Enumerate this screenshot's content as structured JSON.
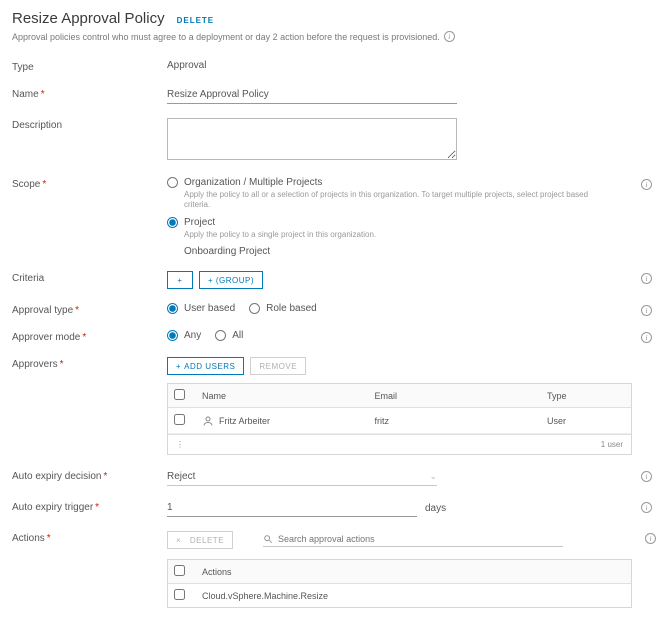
{
  "header": {
    "title": "Resize Approval Policy",
    "delete": "DELETE"
  },
  "subtitle": "Approval policies control who must agree to a deployment or day 2 action before the request is provisioned.",
  "labels": {
    "type": "Type",
    "name": "Name",
    "description": "Description",
    "scope": "Scope",
    "criteria": "Criteria",
    "approval_type": "Approval type",
    "approver_mode": "Approver mode",
    "approvers": "Approvers",
    "auto_expiry_decision": "Auto expiry decision",
    "auto_expiry_trigger": "Auto expiry trigger",
    "actions": "Actions"
  },
  "type_value": "Approval",
  "name_value": "Resize Approval Policy",
  "description_value": "",
  "scope": {
    "org_label": "Organization / Multiple Projects",
    "org_hint": "Apply the policy to all or a selection of projects in this organization. To target multiple projects, select project based criteria.",
    "proj_label": "Project",
    "proj_hint": "Apply the policy to a single project in this organization.",
    "selected_project": "Onboarding Project"
  },
  "criteria": {
    "plus": "+",
    "group": "+ (GROUP)"
  },
  "approval_type": {
    "user": "User based",
    "role": "Role based"
  },
  "approver_mode": {
    "any": "Any",
    "all": "All"
  },
  "approvers": {
    "add": "ADD USERS",
    "remove": "REMOVE",
    "cols": {
      "name": "Name",
      "email": "Email",
      "type": "Type"
    },
    "rows": [
      {
        "name": "Fritz Arbeiter",
        "email": "fritz",
        "type": "User"
      }
    ],
    "footer_count": "1 user"
  },
  "auto_expiry_decision": "Reject",
  "auto_expiry_trigger": {
    "value": "1",
    "unit": "days"
  },
  "actions": {
    "delete": "DELETE",
    "search_placeholder": "Search approval actions",
    "col": "Actions",
    "rows": [
      "Cloud.vSphere.Machine.Resize"
    ]
  }
}
